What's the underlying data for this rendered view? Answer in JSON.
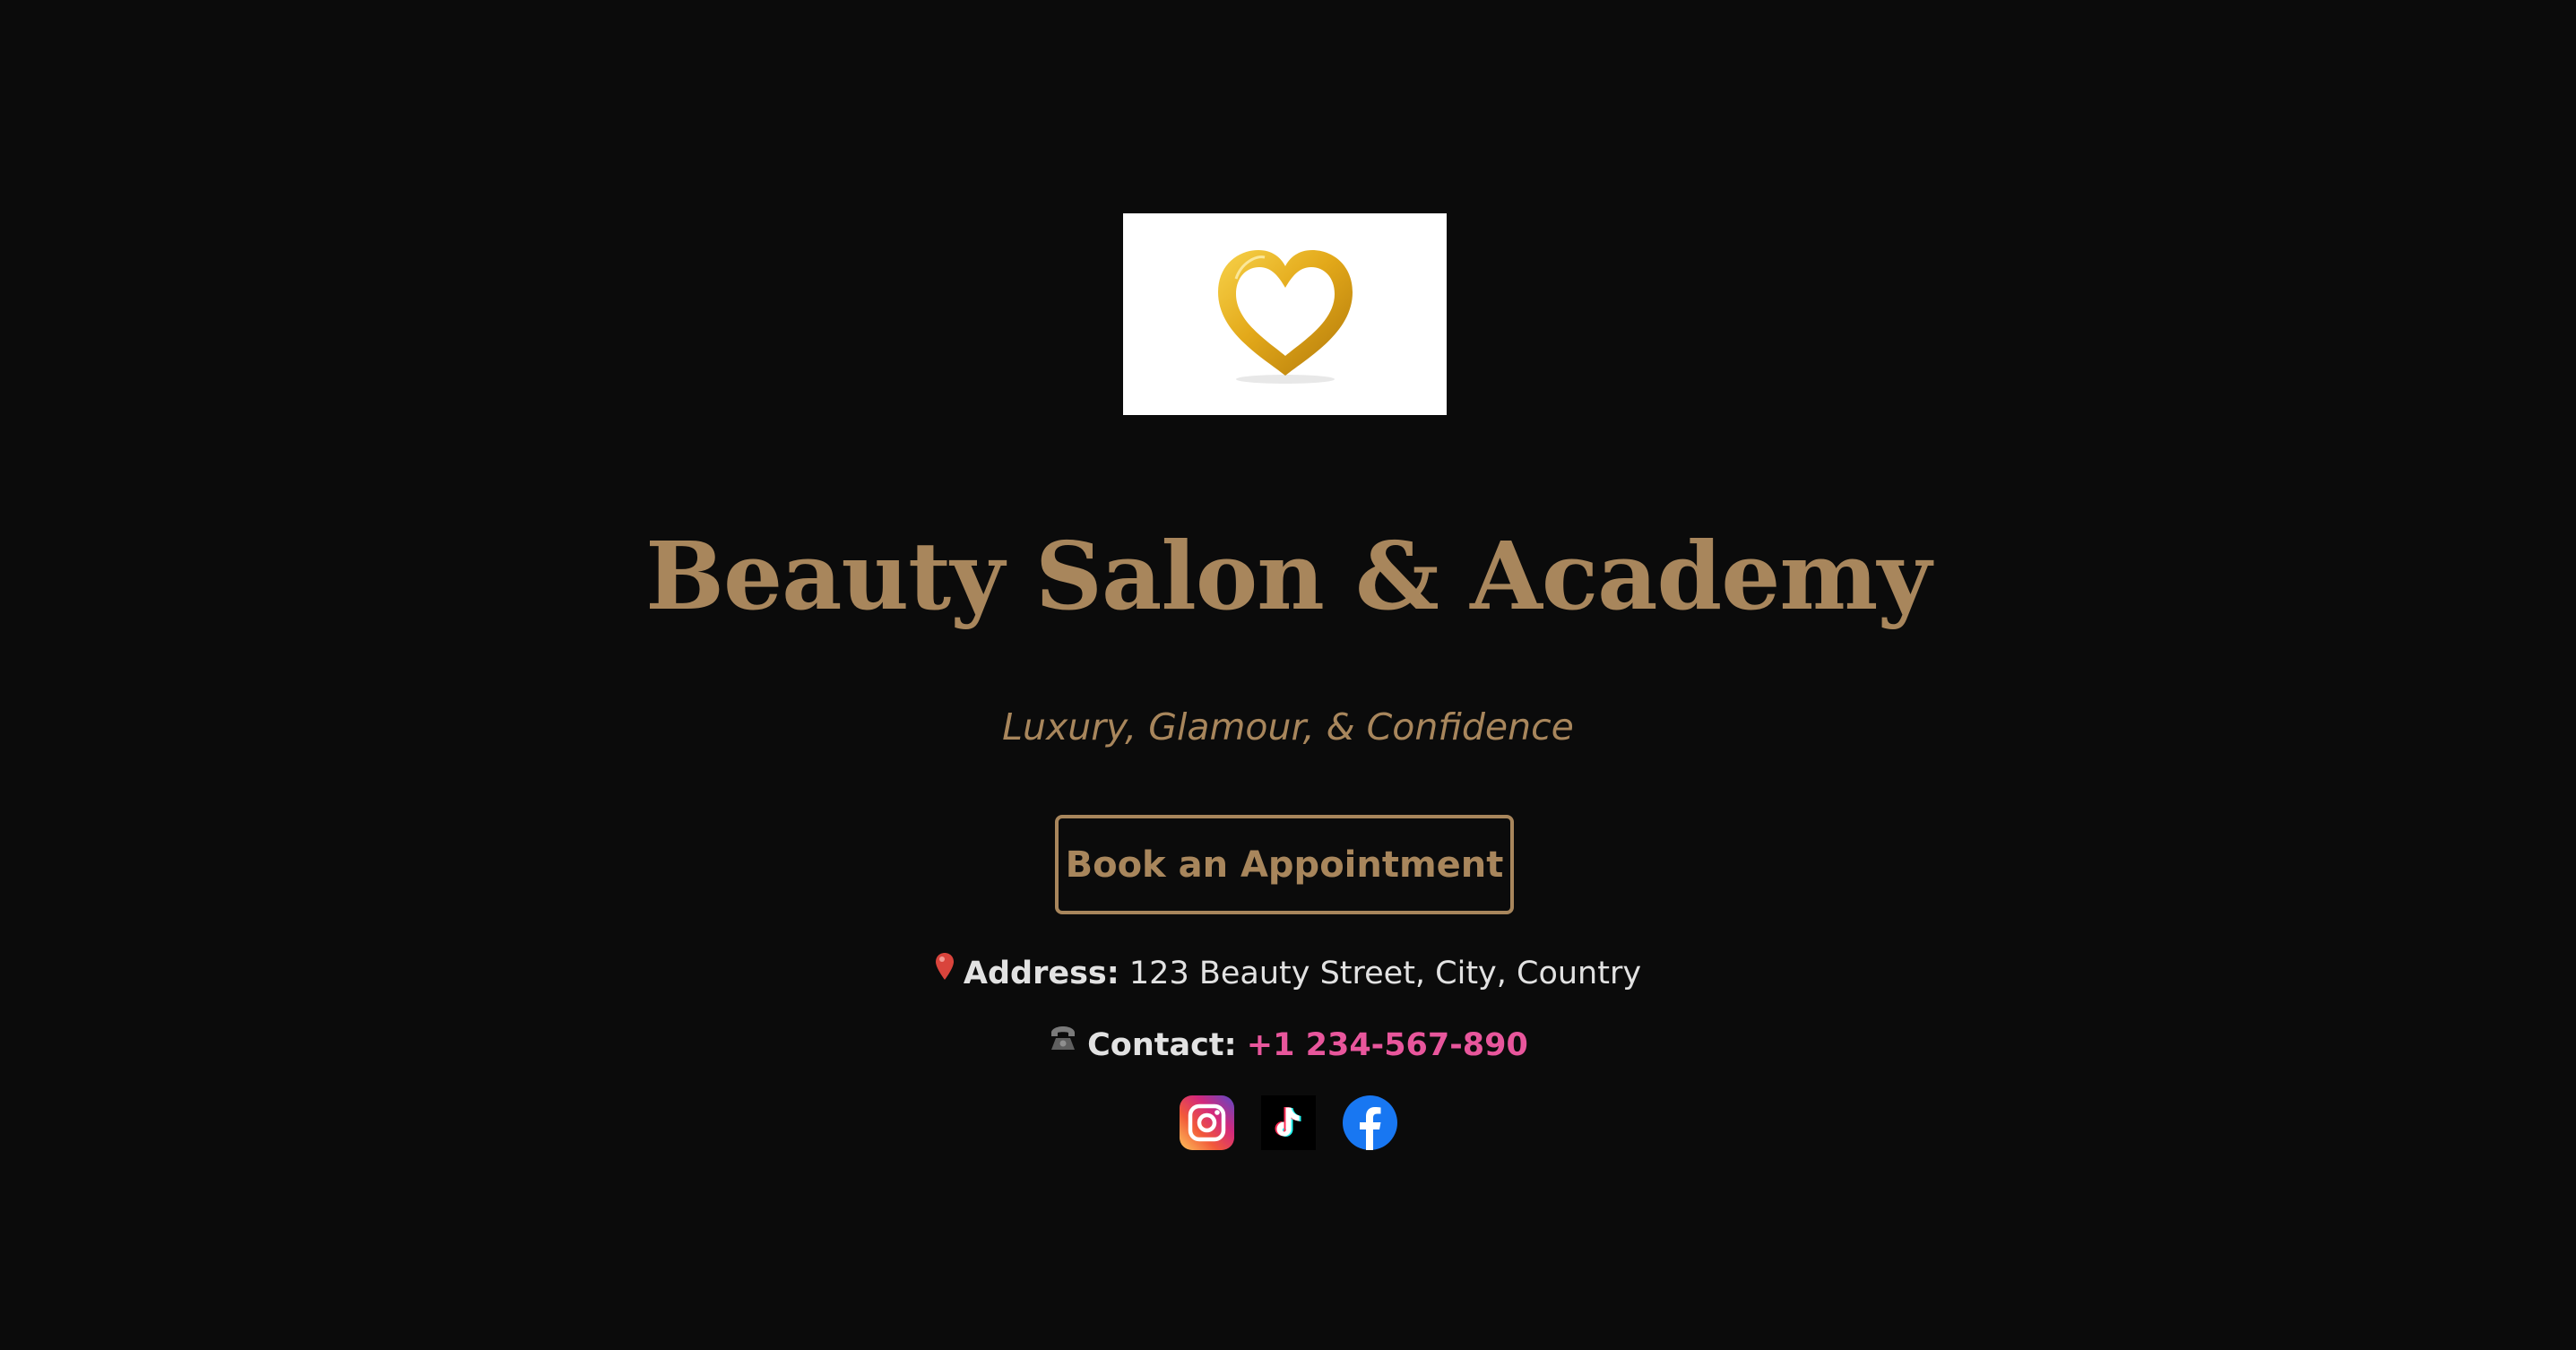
{
  "logo": {
    "icon": "gold-heart-icon"
  },
  "hero": {
    "title": "Beauty Salon & Academy",
    "tagline": "Luxury, Glamour, & Confidence",
    "book_button": "Book an Appointment"
  },
  "info": {
    "address_icon": "pin-icon",
    "address_label": "Address:",
    "address_value": "123 Beauty Street, City, Country",
    "contact_icon": "phone-icon",
    "contact_label": "Contact:",
    "contact_value": "+1 234-567-890"
  },
  "socials": [
    {
      "name": "instagram",
      "icon": "instagram-icon"
    },
    {
      "name": "tiktok",
      "icon": "tiktok-icon"
    },
    {
      "name": "facebook",
      "icon": "facebook-icon"
    }
  ],
  "colors": {
    "background": "#0b0b0b",
    "gold": "#a8865c",
    "phone": "#e8569c",
    "text": "#e2e2e2"
  }
}
